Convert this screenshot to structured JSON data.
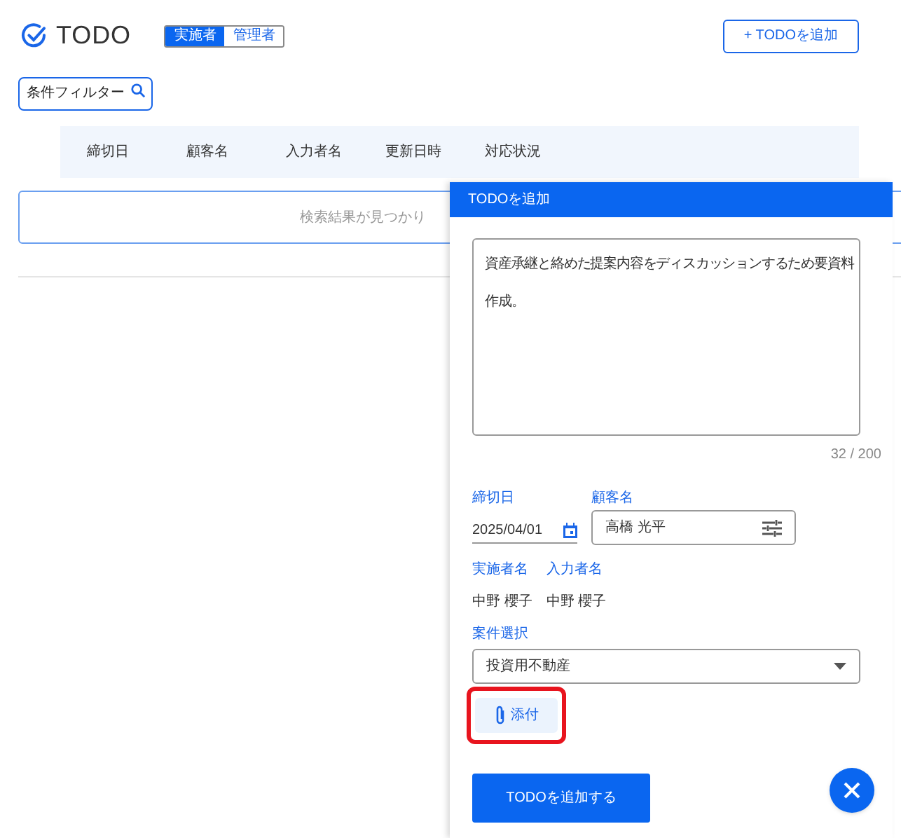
{
  "header": {
    "title": "TODO",
    "roles": [
      {
        "label": "実施者",
        "selected": true
      },
      {
        "label": "管理者",
        "selected": false
      }
    ],
    "add_button": "+ TODOを追加"
  },
  "filter": {
    "placeholder": "条件フィルター"
  },
  "table": {
    "columns": [
      "締切日",
      "顧客名",
      "入力者名",
      "更新日時",
      "対応状況"
    ],
    "empty_message": "検索結果が見つかり"
  },
  "drawer": {
    "title": "TODOを追加",
    "description": {
      "value": "資産承継と絡めた提案内容をディスカッションするため要資料作成。",
      "counter": "32 / 200"
    },
    "due_date": {
      "label": "締切日",
      "value": "2025/04/01"
    },
    "customer": {
      "label": "顧客名",
      "value": "高橋 光平"
    },
    "people": [
      {
        "label": "実施者名",
        "value": "中野 櫻子"
      },
      {
        "label": "入力者名",
        "value": "中野 櫻子"
      }
    ],
    "project": {
      "label": "案件選択",
      "value": "投資用不動産"
    },
    "attach_button": {
      "label": "添付",
      "highlighted": true
    },
    "submit_button": "TODOを追加する"
  }
}
